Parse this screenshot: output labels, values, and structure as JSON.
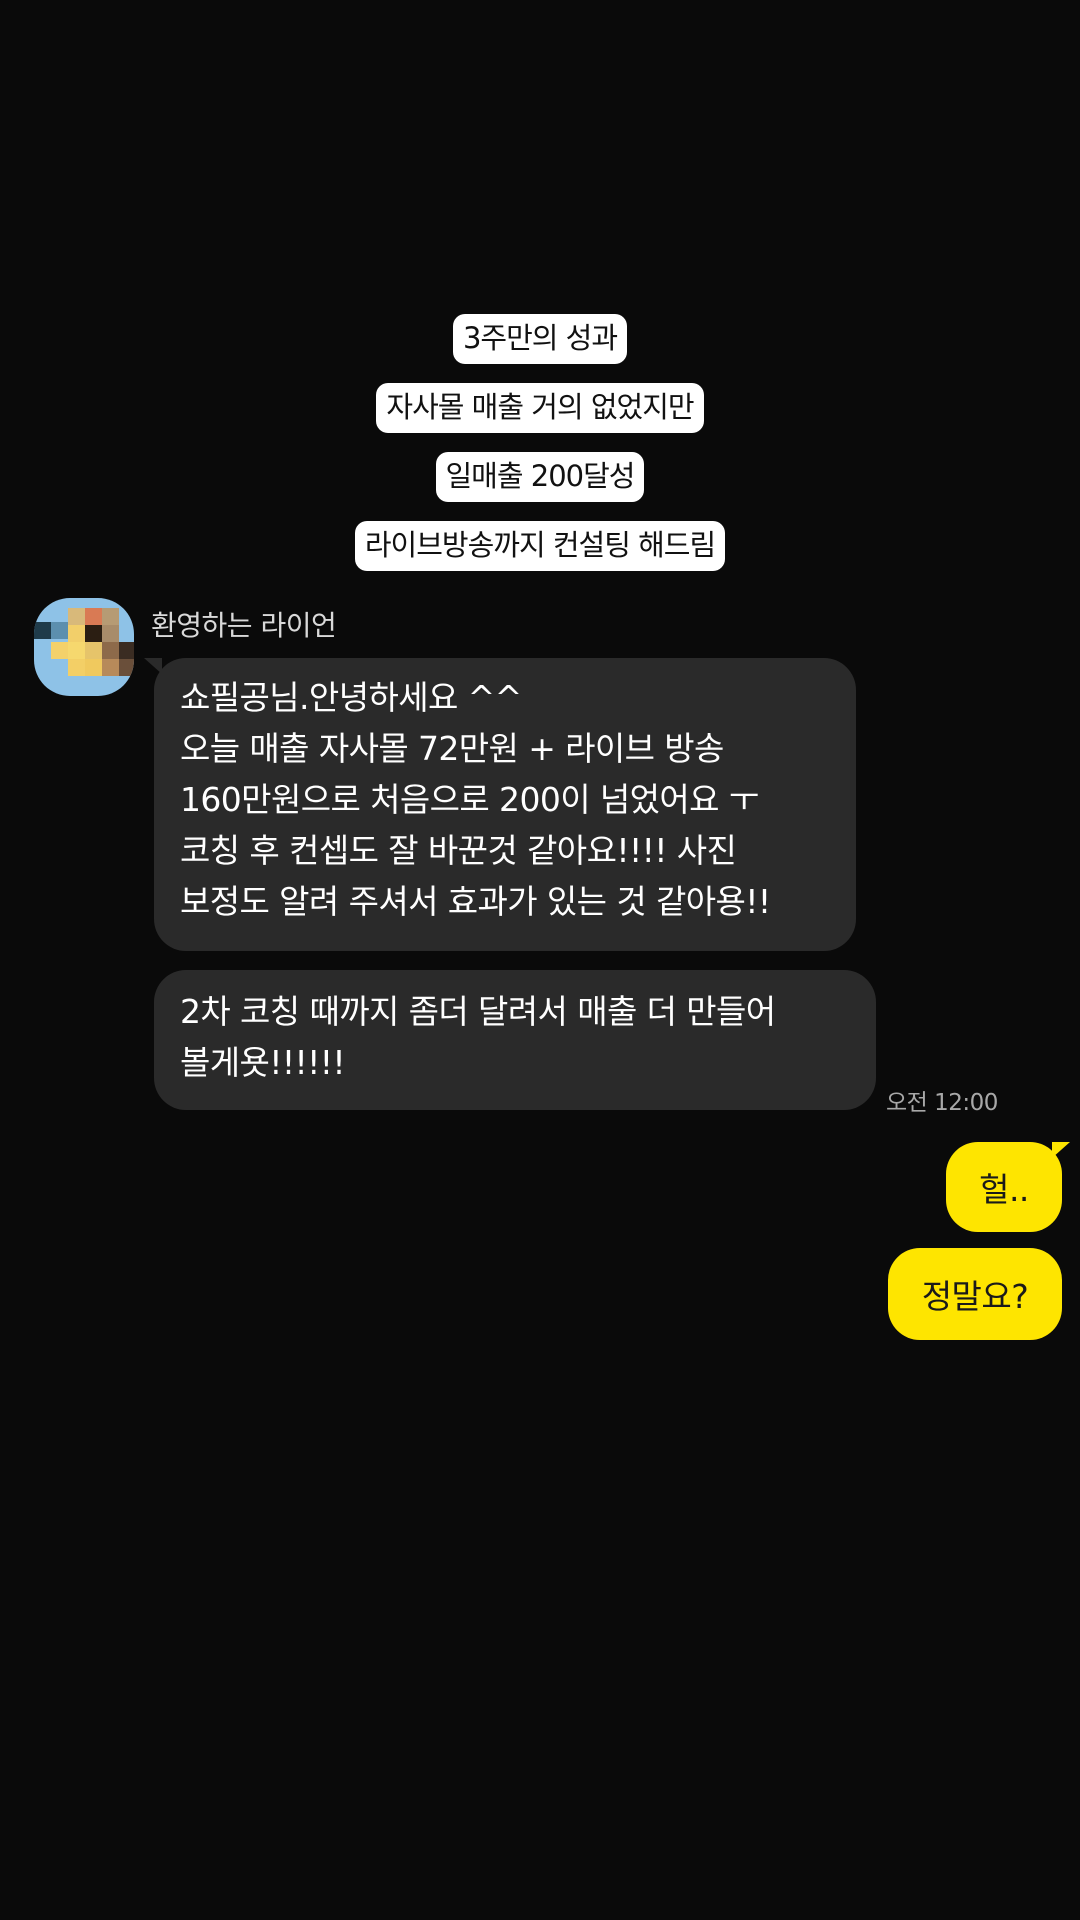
{
  "captions": [
    "3주만의 성과",
    "자사몰 매출 거의 없었지만",
    "일매출 200달성",
    "라이브방송까지 컨설팅 해드림"
  ],
  "chat": {
    "sender_name": "환영하는 라이언",
    "incoming": [
      {
        "lines": [
          "쇼필공님.안녕하세요 ^^",
          "오늘 매출 자사몰 72만원 + 라이브 방송",
          "160만원으로 처음으로 200이 넘었어요 ㅜ",
          "코칭 후 컨셉도 잘 바꾼것 같아요!!!! 사진",
          "보정도 알려 주셔서 효과가 있는 것 같아용!!"
        ]
      },
      {
        "lines": [
          "2차 코칭 때까지 좀더 달려서 매출 더 만들어",
          "볼게욧!!!!!!"
        ]
      }
    ],
    "timestamp": "오전 12:00",
    "outgoing": [
      "헐..",
      "정말요?"
    ],
    "colors": {
      "background": "#0a0a0a",
      "incoming_bubble": "#2a2a2a",
      "outgoing_bubble": "#fee500",
      "caption_box": "#ffffff"
    }
  }
}
